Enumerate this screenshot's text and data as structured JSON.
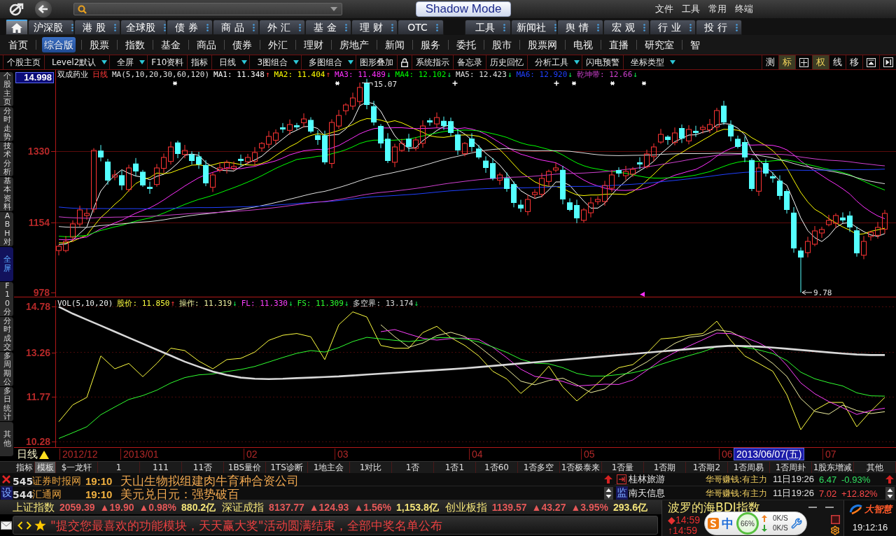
{
  "top_bar": {
    "shadow_mode": "Shadow Mode",
    "menu": [
      "文件",
      "工具",
      "常用",
      "终端"
    ]
  },
  "market_tabs": {
    "home_tab": {
      "selected": true
    },
    "tabs": [
      {
        "label": "沪深股",
        "selected": false
      },
      {
        "label": "港 股",
        "selected": false
      },
      {
        "label": "全球股",
        "selected": false
      },
      {
        "label": "债 券",
        "selected": false
      },
      {
        "label": "商 品",
        "selected": false
      },
      {
        "label": "外 汇",
        "selected": false
      },
      {
        "label": "基 金",
        "selected": false
      },
      {
        "label": "理 财",
        "selected": false
      },
      {
        "label": "OTC",
        "selected": false
      }
    ],
    "tools": [
      {
        "label": "工具",
        "selected": false
      },
      {
        "label": "新闻社",
        "selected": false
      },
      {
        "label": "舆 情",
        "selected": false
      },
      {
        "label": "宏 观",
        "selected": false
      },
      {
        "label": "行 业",
        "selected": false
      },
      {
        "label": "投 行",
        "selected": false
      }
    ]
  },
  "nav": [
    {
      "label": "首页",
      "selected": false
    },
    {
      "label": "综合版",
      "selected": true
    },
    {
      "label": "股票",
      "selected": false
    },
    {
      "label": "指数",
      "selected": false
    },
    {
      "label": "基金",
      "selected": false
    },
    {
      "label": "商品",
      "selected": false
    },
    {
      "label": "债券",
      "selected": false
    },
    {
      "label": "外汇",
      "selected": false
    },
    {
      "label": "理财",
      "selected": false
    },
    {
      "label": "房地产",
      "selected": false
    },
    {
      "label": "新闻",
      "selected": false
    },
    {
      "label": "服务",
      "selected": false
    },
    {
      "label": "委托",
      "selected": false
    },
    {
      "label": "股市",
      "selected": false
    },
    {
      "label": "股票网",
      "selected": false
    },
    {
      "label": "电视",
      "selected": false
    },
    {
      "label": "直播",
      "selected": false
    },
    {
      "label": "研究室",
      "selected": false
    },
    {
      "label": "智",
      "selected": false
    }
  ],
  "toolbar": {
    "left": [
      {
        "kind": "text",
        "label": "个股主页",
        "dropdown": false
      },
      {
        "kind": "text",
        "label": "Level2默认",
        "dropdown": true
      },
      {
        "kind": "text",
        "label": "全屏",
        "dropdown": true
      },
      {
        "kind": "text",
        "label": "F10资料",
        "dropdown": false
      },
      {
        "kind": "text",
        "label": "指标",
        "dropdown": false
      },
      {
        "kind": "text",
        "label": "日线",
        "dropdown": true
      },
      {
        "kind": "text",
        "label": "3图组合",
        "dropdown": true
      },
      {
        "kind": "text",
        "label": "多图组合",
        "dropdown": true
      },
      {
        "kind": "text",
        "label": "图形叠加",
        "dropdown": false
      },
      {
        "kind": "lock"
      },
      {
        "kind": "text",
        "label": "系统指示",
        "dropdown": false
      },
      {
        "kind": "text",
        "label": "备忘录",
        "dropdown": false
      },
      {
        "kind": "text",
        "label": "历史回忆",
        "dropdown": false
      },
      {
        "kind": "text",
        "label": "分析工具",
        "dropdown": true
      },
      {
        "kind": "text",
        "label": "闪电预警",
        "dropdown": false
      },
      {
        "kind": "text",
        "label": "坐标类型",
        "dropdown": true
      }
    ],
    "right": [
      {
        "kind": "text",
        "label": "测",
        "selected": false
      },
      {
        "kind": "text",
        "label": "标",
        "selected": true
      },
      {
        "kind": "grid",
        "selected": false
      },
      {
        "kind": "text",
        "label": "权",
        "selected": true
      },
      {
        "kind": "text",
        "label": "线",
        "selected": false
      },
      {
        "kind": "text",
        "label": "移",
        "selected": false
      },
      {
        "kind": "panel",
        "selected": false
      },
      {
        "kind": "end",
        "selected": false
      }
    ]
  },
  "side_tabs": [
    {
      "label": "个股主页",
      "selected": false
    },
    {
      "label": "分时走势",
      "selected": false
    },
    {
      "label": "技术分析",
      "selected": false
    },
    {
      "label": "基本资料",
      "selected": false
    },
    {
      "label": "ABH对",
      "selected": false
    },
    {
      "label": "全屏",
      "selected": true
    },
    {
      "label": "F10分",
      "selected": false
    },
    {
      "label": "分时成交",
      "selected": false
    },
    {
      "label": "多周期公",
      "selected": false
    },
    {
      "label": "多日统计",
      "selected": false
    },
    {
      "label": "其他",
      "selected": false
    }
  ],
  "price_chart": {
    "stock": "双成药业",
    "period": "日线",
    "formula": "MA(5,10,20,30,60,120)",
    "indicators": [
      {
        "label": "MA1: 11.348",
        "arrow": "↑",
        "rising": true,
        "color": "#ffffff"
      },
      {
        "label": "MA2: 11.404",
        "arrow": "↑",
        "rising": true,
        "color": "#ffff00"
      },
      {
        "label": "MA3: 11.489",
        "arrow": "↓",
        "rising": false,
        "color": "#ff30ff"
      },
      {
        "label": "MA4: 12.102",
        "arrow": "↓",
        "rising": false,
        "color": "#00ff00"
      },
      {
        "label": "MA5: 12.423",
        "arrow": "↓",
        "rising": false,
        "color": "#e0e0e0"
      },
      {
        "label": "MA6: 12.920",
        "arrow": "↓",
        "rising": false,
        "color": "#2040ff"
      },
      {
        "label": "乾坤带: 12.66",
        "arrow": "↓",
        "rising": false,
        "color": "#d040d0"
      }
    ],
    "axis_labels": [
      {
        "label": "14.998",
        "kind": "current"
      },
      {
        "label": "1330",
        "kind": "tick"
      },
      {
        "label": "1154",
        "kind": "tick"
      },
      {
        "label": "978",
        "kind": "tick"
      }
    ],
    "high_label": "15.07",
    "low_label": "9.78"
  },
  "volume_chart": {
    "title": "VOL(5,10,20)",
    "readings": [
      {
        "value": ": 11.850",
        "arrow": "↑",
        "rising": true
      },
      {
        "value": ": 11.319",
        "arrow": "↓",
        "rising": false
      },
      {
        "value": ": 11.330",
        "arrow": "↓",
        "rising": false
      },
      {
        "value": ": 11.309",
        "arrow": "↓",
        "rising": false
      },
      {
        "value": ": 13.174",
        "arrow": "↓",
        "rising": false
      }
    ],
    "chart_data": {
      "type": "line",
      "ylim": [
        10.1,
        15.0
      ],
      "yticks": [
        14.78,
        13.26,
        11.77,
        10.28
      ],
      "grid": true,
      "series": [
        {
          "name": "股价",
          "color": "#ffff40",
          "values": [
            10.95,
            11.51,
            11.76,
            13.14,
            12.71,
            12.89,
            12.45,
            12.89,
            13.4,
            13.32,
            12.97,
            12.71,
            13.02,
            13.06,
            13.27,
            13.66,
            13.83,
            13.89,
            13.78,
            13.02,
            14.18,
            14.61,
            14.44,
            13.49,
            13.4,
            13.4,
            13.92,
            14.13,
            13.75,
            13.49,
            13.14,
            12.63,
            12.37,
            11.89,
            12.28,
            12.8,
            12.11,
            11.64,
            12.02,
            12.45,
            12.75,
            12.85,
            13.23,
            13.71,
            13.75,
            13.83,
            13.89,
            14.3,
            13.66,
            13.14,
            12.89,
            12.63,
            11.85,
            10.68,
            11.33,
            11.59,
            11.59,
            10.78,
            11.3,
            11.76
          ]
        },
        {
          "name": "操作",
          "color": "#f0f0a0",
          "values": [
            null,
            null,
            null,
            null,
            null,
            null,
            null,
            null,
            null,
            null,
            null,
            null,
            null,
            null,
            null,
            null,
            null,
            null,
            null,
            null,
            null,
            null,
            null,
            14.18,
            13.78,
            13.43,
            13.57,
            13.82,
            13.93,
            13.79,
            13.46,
            13.09,
            12.71,
            12.3,
            12.18,
            12.32,
            12.4,
            12.18,
            11.92,
            12.04,
            12.41,
            12.68,
            12.94,
            13.26,
            13.56,
            13.76,
            13.82,
            14.01,
            13.95,
            13.7,
            13.23,
            12.89,
            12.46,
            11.72,
            11.29,
            11.2,
            11.5,
            11.32,
            11.22,
            11.28
          ]
        },
        {
          "name": "FL",
          "color": "#ff40ff",
          "values": [
            null,
            null,
            null,
            null,
            null,
            null,
            null,
            null,
            null,
            null,
            null,
            null,
            null,
            null,
            null,
            null,
            null,
            null,
            null,
            null,
            null,
            null,
            null,
            13.95,
            14.02,
            13.87,
            13.73,
            13.67,
            13.72,
            13.74,
            13.69,
            13.43,
            13.08,
            12.7,
            12.46,
            12.39,
            12.29,
            12.14,
            12.17,
            12.2,
            12.19,
            12.34,
            12.66,
            13.0,
            13.26,
            13.47,
            13.68,
            13.9,
            13.89,
            13.76,
            13.58,
            13.32,
            12.83,
            12.24,
            11.88,
            11.62,
            11.41,
            11.19,
            11.32,
            11.4
          ]
        },
        {
          "name": "FS",
          "color": "#30ff30",
          "values": [
            10.39,
            10.58,
            10.78,
            11.18,
            11.44,
            11.69,
            11.82,
            12.0,
            12.24,
            12.42,
            12.51,
            12.54,
            12.62,
            12.69,
            12.79,
            12.94,
            13.09,
            13.23,
            13.32,
            13.27,
            13.42,
            13.62,
            13.76,
            13.71,
            13.66,
            13.62,
            13.67,
            13.75,
            13.75,
            13.71,
            13.61,
            13.44,
            13.26,
            13.03,
            12.9,
            12.88,
            12.75,
            12.56,
            12.47,
            12.47,
            12.52,
            12.58,
            12.69,
            12.86,
            13.01,
            13.15,
            13.28,
            13.45,
            13.49,
            13.43,
            13.34,
            13.22,
            12.99,
            12.6,
            12.38,
            12.25,
            12.14,
            11.91,
            11.81,
            11.8
          ]
        },
        {
          "name": "多空界",
          "color": "#d8d8d8",
          "values": [
            14.78,
            14.55,
            14.35,
            14.15,
            13.95,
            13.75,
            13.55,
            13.35,
            13.15,
            12.95,
            12.78,
            12.62,
            12.5,
            12.42,
            12.38,
            12.37,
            12.38,
            12.4,
            12.42,
            12.44,
            12.46,
            12.49,
            12.52,
            12.55,
            12.58,
            12.61,
            12.64,
            12.67,
            12.7,
            12.73,
            12.77,
            12.81,
            12.85,
            12.89,
            12.93,
            12.97,
            13.01,
            13.05,
            13.09,
            13.13,
            13.17,
            13.21,
            13.25,
            13.29,
            13.33,
            13.37,
            13.41,
            13.45,
            13.48,
            13.47,
            13.45,
            13.42,
            13.38,
            13.34,
            13.3,
            13.26,
            13.22,
            13.19,
            13.17,
            13.17
          ]
        }
      ]
    }
  },
  "date_axis": {
    "period": "日线",
    "labels": [
      "2012/12",
      "2013/01",
      "02",
      "03",
      "04",
      "05",
      "06",
      "07"
    ],
    "cursor_date": "2013/06/07(五)"
  },
  "indicator_tabs": [
    {
      "label": "指标",
      "selected": false
    },
    {
      "label": "模板",
      "selected": true
    },
    {
      "label": "$一龙轩",
      "selected": false
    },
    {
      "label": "1",
      "selected": false
    },
    {
      "label": "111",
      "selected": false
    },
    {
      "label": "11否",
      "selected": false
    },
    {
      "label": "1BS量价",
      "selected": false
    },
    {
      "label": "1TS诊断",
      "selected": false
    },
    {
      "label": "1地主会",
      "selected": false
    },
    {
      "label": "1对比",
      "selected": false
    },
    {
      "label": "1否",
      "selected": false
    },
    {
      "label": "1否1",
      "selected": false
    },
    {
      "label": "1否60",
      "selected": false
    },
    {
      "label": "1否多空",
      "selected": false
    },
    {
      "label": "1否极泰来",
      "selected": false
    },
    {
      "label": "1否量",
      "selected": false
    },
    {
      "label": "1否期",
      "selected": false
    },
    {
      "label": "1否期2",
      "selected": false
    },
    {
      "label": "1否周易",
      "selected": false
    },
    {
      "label": "1否周卦",
      "selected": false
    },
    {
      "label": "1股东增减",
      "selected": false
    },
    {
      "label": "其他",
      "selected": false
    }
  ],
  "news": [
    {
      "kind": "close",
      "number": "545",
      "source": "证券时报网",
      "time": "19:10",
      "headline": "天山生物拟组建肉牛育种合资公司"
    },
    {
      "kind": "label",
      "marker": "设",
      "number": "544",
      "source": "汇通网",
      "time": "19:10",
      "headline": "美元兑日元：强势破百"
    }
  ],
  "watchlist": [
    {
      "kind": "icon",
      "stock": "桂林旅游",
      "signal": "华哥赚钱:有主力",
      "time": "11日19:26",
      "price": "6.47",
      "change": "-0.93%",
      "rising": false
    },
    {
      "kind": "label",
      "marker": "监",
      "stock": "南天信息",
      "signal": "华哥赚钱:有主力",
      "time": "11日19:26",
      "price": "7.02",
      "change": "+12.82%",
      "rising": true
    }
  ],
  "indices": [
    {
      "name": "上证指数",
      "value": "2059.39",
      "change": "▲19.90",
      "percent": "▲0.98%",
      "turnover": "880.2亿"
    },
    {
      "name": "深证成指",
      "value": "8137.77",
      "change": "▲124.93",
      "percent": "▲1.56%",
      "turnover": "1,153.8亿"
    },
    {
      "name": "创业板指",
      "value": "1139.57",
      "change": "▲43.27",
      "percent": "▲3.95%",
      "turnover": "293.6亿"
    }
  ],
  "bdi": {
    "title": "波罗的海BDI指数",
    "rows": [
      "◆14:59",
      "↑14:59"
    ]
  },
  "ticker": {
    "message": "\"提交您最喜欢的功能模块，天天赢大奖\"活动圆满结束，全部中奖名单公布"
  },
  "ime": {
    "mode": "中",
    "usage": "66%",
    "upload": "0K/S",
    "download": "0K/S"
  },
  "clock": {
    "brand": "大智慧",
    "time": "19:12:16"
  }
}
